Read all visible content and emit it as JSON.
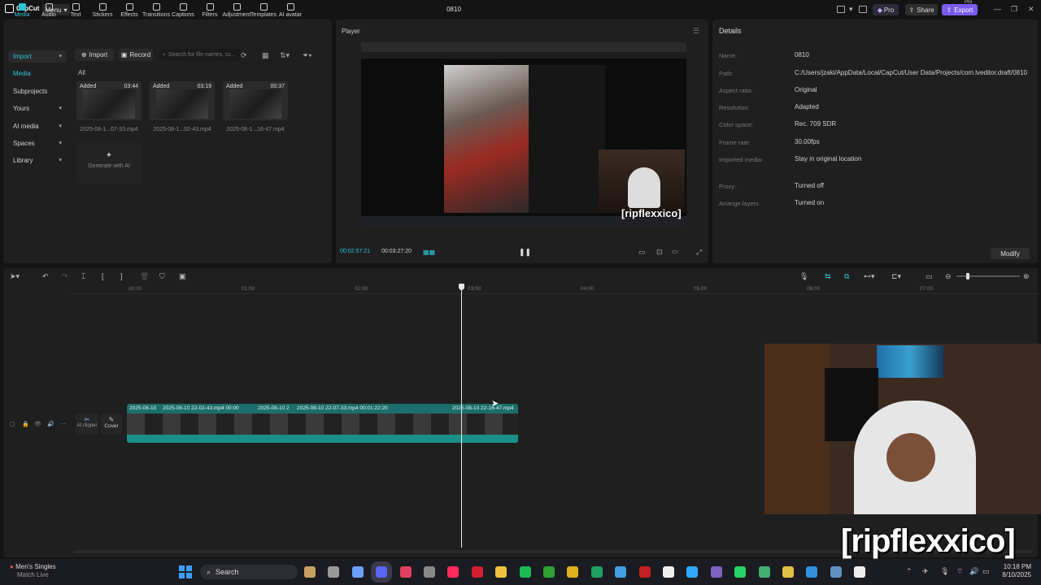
{
  "app": {
    "logo_text": "CapCut",
    "menu_label": "Menu",
    "project_title": "0810",
    "pro_label": "Pro",
    "share_label": "Share",
    "export_label": "Export",
    "export_pro_tag": "Pro"
  },
  "media_tools": [
    "Media",
    "Audio",
    "Text",
    "Stickers",
    "Effects",
    "Transitions",
    "Captions",
    "Filters",
    "Adjustment",
    "Templates",
    "AI avatar"
  ],
  "media_sidebar": [
    {
      "label": "Import",
      "chevron": true,
      "state": "hl"
    },
    {
      "label": "Media",
      "chevron": false,
      "state": "active"
    },
    {
      "label": "Subprojects",
      "chevron": false,
      "state": ""
    },
    {
      "label": "Yours",
      "chevron": true,
      "state": ""
    },
    {
      "label": "AI media",
      "chevron": true,
      "state": ""
    },
    {
      "label": "Spaces",
      "chevron": true,
      "state": ""
    },
    {
      "label": "Library",
      "chevron": true,
      "state": ""
    }
  ],
  "media_actions": {
    "import_label": "Import",
    "record_label": "Record",
    "search_placeholder": "Search for file names, sc...",
    "all_label": "All"
  },
  "media_items": [
    {
      "added": "Added",
      "duration": "03:44",
      "name": "2025-08-1...07-33.mp4"
    },
    {
      "added": "Added",
      "duration": "03:19",
      "name": "2025-08-1...02-43.mp4"
    },
    {
      "added": "Added",
      "duration": "00:37",
      "name": "2025-08-1...16-47.mp4"
    }
  ],
  "generate_ai_label": "Generate with AI",
  "player": {
    "label": "Player",
    "current_time": "00:02:57:21",
    "total_time": "00:03:27:20",
    "caption": "[ripflexxico]"
  },
  "details": {
    "title": "Details",
    "rows": [
      {
        "label": "Name:",
        "value": "0810"
      },
      {
        "label": "Path:",
        "value": "C:/Users/jzaki/AppData/Local/CapCut/User Data/Projects/com.lveditor.draft/0810"
      },
      {
        "label": "Aspect ratio:",
        "value": "Original"
      },
      {
        "label": "Resolution:",
        "value": "Adapted"
      },
      {
        "label": "Color space:",
        "value": "Rec. 709 SDR"
      },
      {
        "label": "Frame rate:",
        "value": "30.00fps"
      },
      {
        "label": "Imported media:",
        "value": "Stay in original location"
      },
      {
        "label": "Proxy:",
        "value": "Turned off"
      },
      {
        "label": "Arrange layers",
        "value": "Turned on"
      }
    ],
    "modify_label": "Modify"
  },
  "timeline": {
    "ruler": [
      "00:00",
      "01:00",
      "02:00",
      "03:00",
      "04:00",
      "05:00",
      "06:00",
      "07:00"
    ],
    "track_labels": {
      "ai_clipper": "AI clipper",
      "cover": "Cover"
    },
    "clip_labels": [
      "2025-08-10",
      "2025-08-10 22-02-43.mp4  00:00",
      "2025-08-10 2",
      "2025-08-10 22-07-33.mp4  00:01:22:20",
      "2025-08-10 22-16-47.mp4"
    ]
  },
  "overlay_caption": "[ripflexxico]",
  "taskbar": {
    "weather_title": "Men's Singles",
    "weather_sub": "Match Live",
    "search_label": "Search",
    "time": "10:18 PM",
    "date": "8/10/2025"
  },
  "colors": {
    "accent": "#2fc4d8",
    "export": "#7b5cf0",
    "clip": "#1b6e6b"
  }
}
